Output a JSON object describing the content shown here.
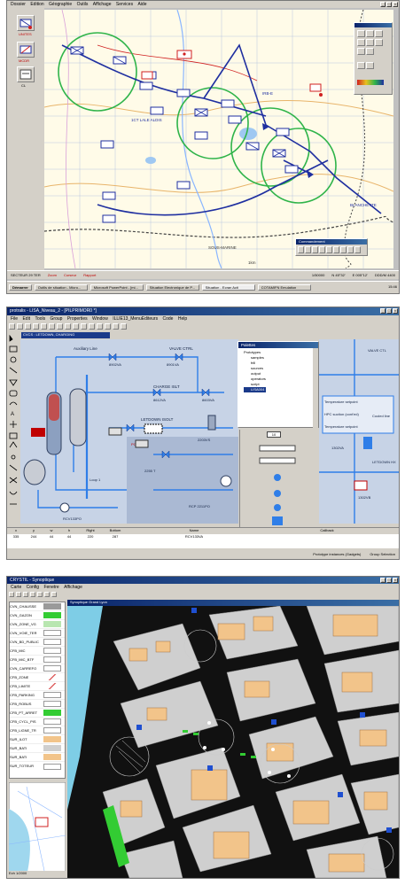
{
  "shot1": {
    "menu": [
      "Dossier",
      "Edition",
      "Géographie",
      "Outils",
      "Affichage",
      "Services",
      "Aide"
    ],
    "left_tools": [
      "UNITES",
      "MCDR"
    ],
    "label_corner": "CL",
    "map_label_1": "1CT LALE ALDIS",
    "map_label_2": "IRB-E",
    "map_label_3": "BLANCHETTE",
    "bottom_label": "SOUS-MARINE",
    "scale_label": "1km",
    "commandement_title": "Commandement",
    "status": [
      "SECTEUR 29 TER",
      "Zoom",
      "Curseur",
      "Rapport"
    ],
    "status_right": [
      "1/50000",
      "N 45°32'",
      "E 005°12'",
      "DDD/M 4400"
    ],
    "taskbar": {
      "start": "Démarrer",
      "items": [
        "Outils de situation - Micro...",
        "Microsoft PowerPoint - [mi...",
        "Situation Electronique de P...",
        "Situation - Ecran Acti",
        "COTAMIFN Emulation"
      ],
      "clock": "15:46"
    },
    "colors": {
      "map_bg": "#fffbe8",
      "unit_blue": "#1f2fa0",
      "circle_green": "#2fb44a",
      "enemy_red": "#d02020"
    }
  },
  "shot2": {
    "title": "protralis - LISA_Niveau_2 - [PILPRIMOR0 *]",
    "menu": [
      "File",
      "Edit",
      "Tools",
      "Group",
      "Properties",
      "Window",
      "ILLIE13_MenuEditeurs",
      "Code",
      "Help"
    ],
    "tab": "CVCS : LETDOWN, CHARGING",
    "labels": {
      "aux_line": "Auxiliary Line",
      "charge_isolt": "CHARGE ISLT",
      "valve_ctrl": "VALVE CTRL",
      "letdown_isolt": "LETDOWN ISOLT",
      "v1": "8902VA",
      "v2": "8901VA",
      "v3": "8612VA",
      "v4": "8603VA",
      "loop1": "Loop 1",
      "pump": "RCV133PO",
      "pcv": "PCV 10 13",
      "rcp": "RCP 2211PO",
      "cvcs_tank": "2255 T",
      "pct": "1302VA",
      "pct2": "1302VB",
      "temp1": "Temperature setpoint",
      "temp2": "HPC suction (cont'ed)",
      "temp3": "Temperature setpoint",
      "coldel": "Cooled line",
      "v_right": "VALVE CTL",
      "letdown_hx": "LETDOWN HX",
      "xtra": "2203VS"
    },
    "palette": {
      "title": "Palettes",
      "items": [
        "Prototypes",
        "samples",
        "frill",
        "sources",
        "output",
        "operators",
        "script",
        "LISA004"
      ],
      "selected_index": 7
    },
    "value_box": "10",
    "table_headers": [
      "x",
      "y",
      "w",
      "h",
      "Right",
      "Bottom",
      "Name",
      "Callback"
    ],
    "table_row": [
      "335",
      "244",
      "44",
      "44",
      "220",
      "287",
      "RCV133VA",
      ""
    ],
    "status": [
      "Prototype instances (Gadgets)",
      "Group Selection"
    ]
  },
  "shot3": {
    "title": "CRYSTIL - Synoptique",
    "menu": [
      "Carte",
      "Config",
      "Fenetre",
      "Affichage"
    ],
    "subwindow_title": "Synoptique Grand Lyon",
    "layers": [
      "CVN_CHAUSSE",
      "CVN_GAZON",
      "CVN_ZONE_VG",
      "CVN_VOIE_TER",
      "CVN_BD_PUBLIC",
      "CFB_MIC",
      "CFB_MIC_BTF",
      "CVN_CARREFO",
      "CFB_ZONE",
      "CFB_LIMITE",
      "CFB_PARKING",
      "CFB_ROBUS",
      "CFB_PT_ARRET",
      "CFB_CYCL_PIS",
      "CFB_LIGNE_TR",
      "SUR_ILOT",
      "SUR_BATI",
      "SUR_BATI",
      "SUR_TOTEUR"
    ],
    "status": "Ech 1/2000",
    "colors": {
      "road": "#111111",
      "block": "#cfcfcf",
      "building": "#f2c48a",
      "water": "#7ecde6",
      "green": "#33cc33"
    }
  }
}
